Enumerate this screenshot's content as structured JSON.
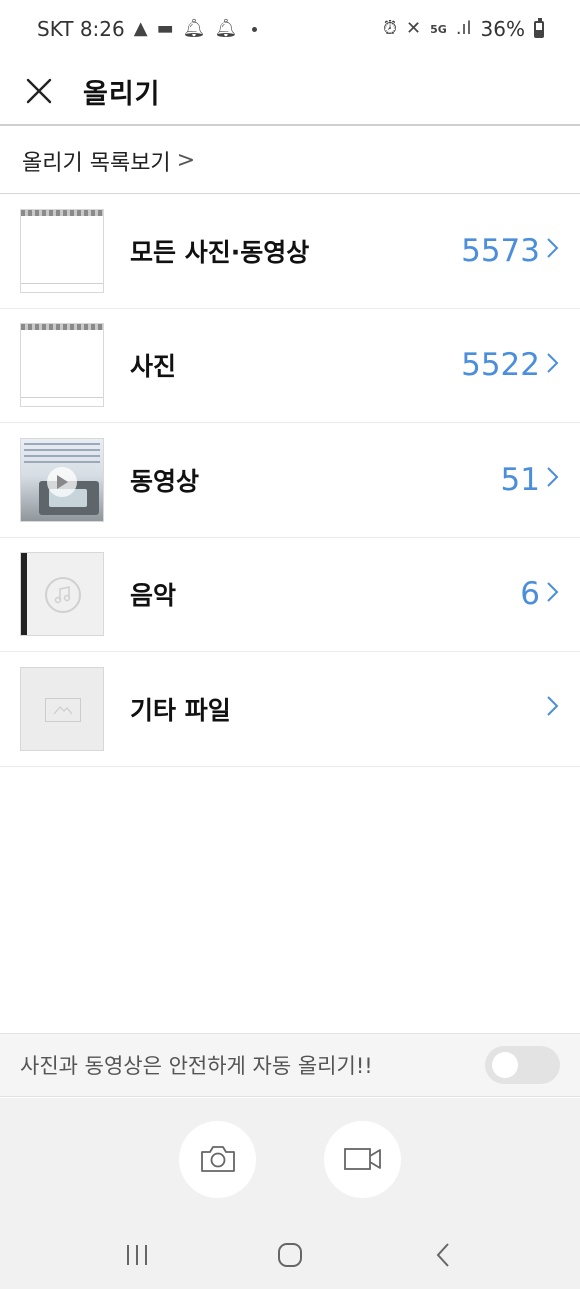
{
  "status_bar": {
    "carrier_time": "SKT 8:26",
    "network": "5G",
    "battery": "36%"
  },
  "header": {
    "title": "올리기"
  },
  "upload_list_link": {
    "label": "올리기 목록보기",
    "chevron": ">"
  },
  "categories": [
    {
      "label": "모든 사진·동영상",
      "count": "5573",
      "chevron": ">"
    },
    {
      "label": "사진",
      "count": "5522",
      "chevron": ">"
    },
    {
      "label": "동영상",
      "count": "51",
      "chevron": ">"
    },
    {
      "label": "음악",
      "count": "6",
      "chevron": ">"
    },
    {
      "label": "기타 파일",
      "count": "",
      "chevron": ">"
    }
  ],
  "auto_upload": {
    "label": "사진과 동영상은 안전하게 자동 올리기!!",
    "enabled": false
  },
  "icons": {
    "close": "close-icon",
    "camera": "camera-icon",
    "video": "video-camera-icon",
    "recent_apps": "recent-apps-icon",
    "home": "home-icon",
    "back": "back-icon"
  },
  "colors": {
    "accent": "#4a8edc",
    "toggle_off": "#e3e3e3"
  }
}
